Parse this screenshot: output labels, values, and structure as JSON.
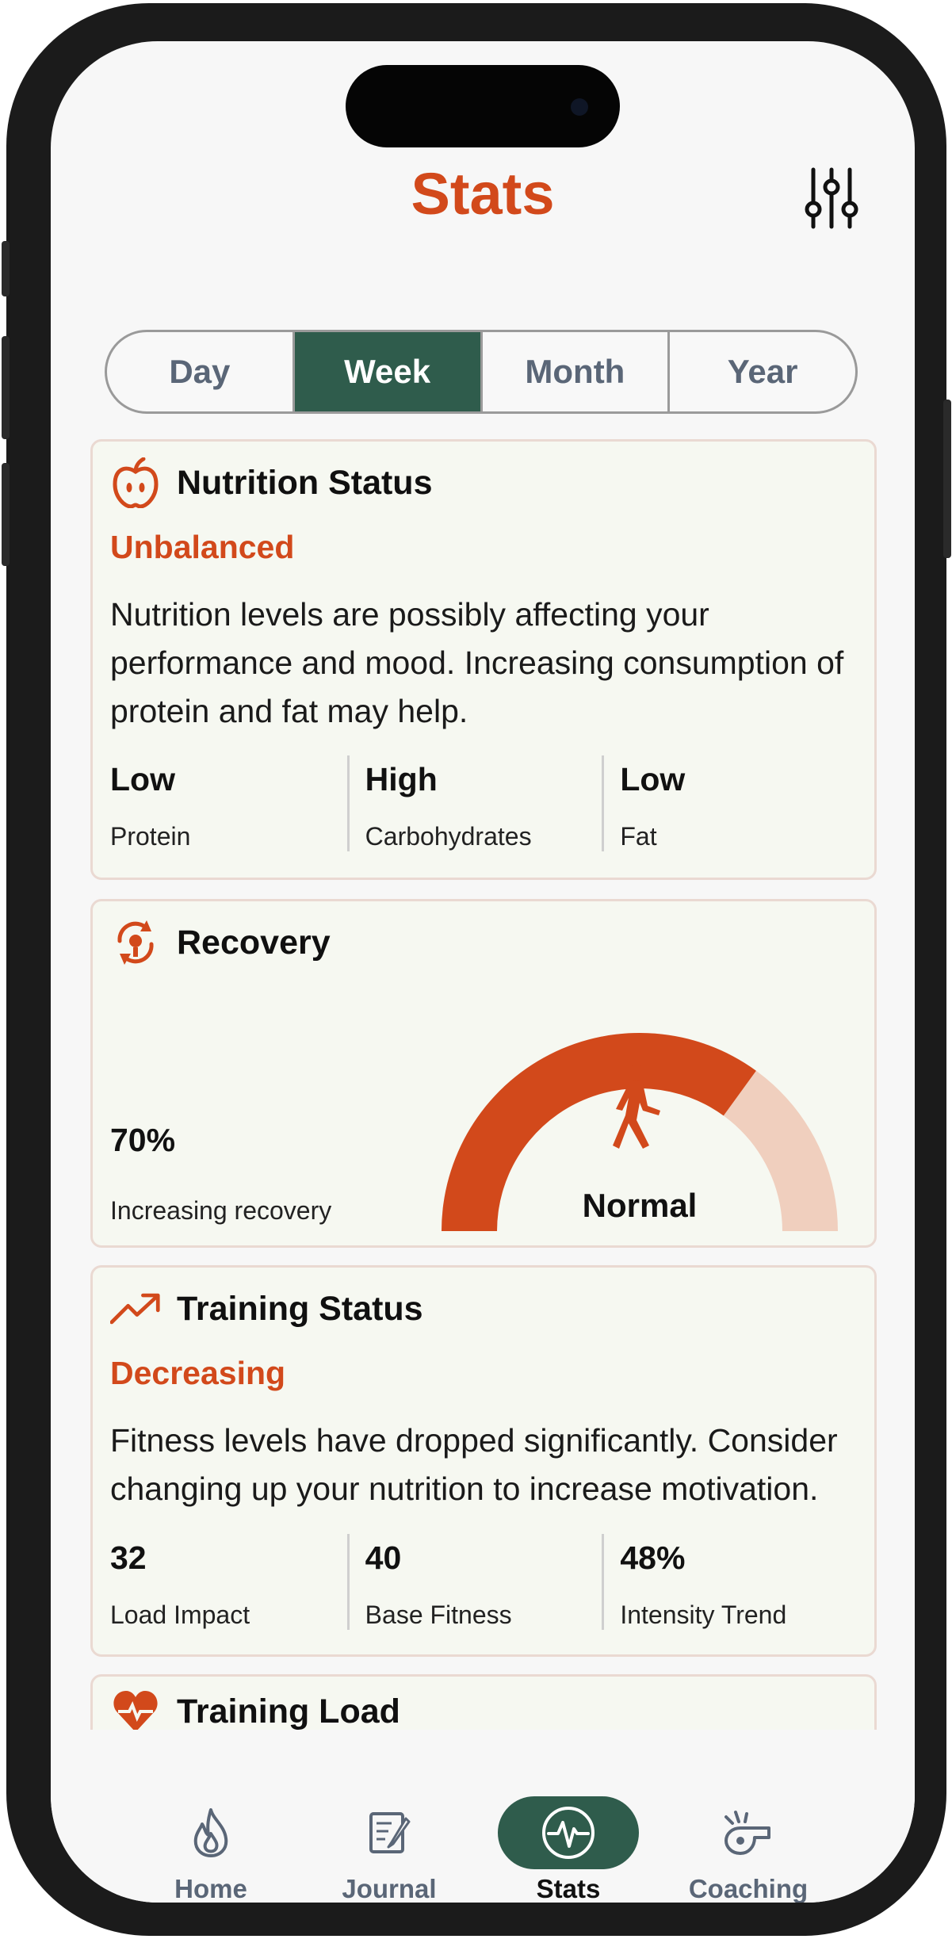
{
  "header": {
    "title": "Stats"
  },
  "period_tabs": [
    {
      "label": "Day",
      "active": false
    },
    {
      "label": "Week",
      "active": true
    },
    {
      "label": "Month",
      "active": false
    },
    {
      "label": "Year",
      "active": false
    }
  ],
  "nutrition": {
    "title": "Nutrition Status",
    "status": "Unbalanced",
    "description": "Nutrition levels are possibly affecting your performance and mood. Increasing consumption of protein and fat may help.",
    "metrics": [
      {
        "value": "Low",
        "label": "Protein"
      },
      {
        "value": "High",
        "label": "Carbohydrates"
      },
      {
        "value": "Low",
        "label": "Fat"
      }
    ]
  },
  "recovery": {
    "title": "Recovery",
    "value": "70%",
    "caption": "Increasing recovery",
    "gauge_label": "Normal",
    "gauge_fraction": 0.7
  },
  "training": {
    "title": "Training Status",
    "status": "Decreasing",
    "description": "Fitness levels have dropped significantly. Consider changing up your nutrition to increase motivation.",
    "metrics": [
      {
        "value": "32",
        "label": "Load Impact"
      },
      {
        "value": "40",
        "label": "Base Fitness"
      },
      {
        "value": "48%",
        "label": "Intensity Trend"
      }
    ]
  },
  "training_load": {
    "title": "Training Load"
  },
  "nav": [
    {
      "label": "Home",
      "icon": "flame-icon",
      "active": false
    },
    {
      "label": "Journal",
      "icon": "journal-icon",
      "active": false
    },
    {
      "label": "Stats",
      "icon": "pulse-icon",
      "active": true
    },
    {
      "label": "Coaching",
      "icon": "whistle-icon",
      "active": false
    }
  ],
  "colors": {
    "accent": "#d2491b",
    "accent_light": "#f0cfbe",
    "brand_green": "#2f5c4c",
    "card_bg": "#f6f8f1"
  }
}
